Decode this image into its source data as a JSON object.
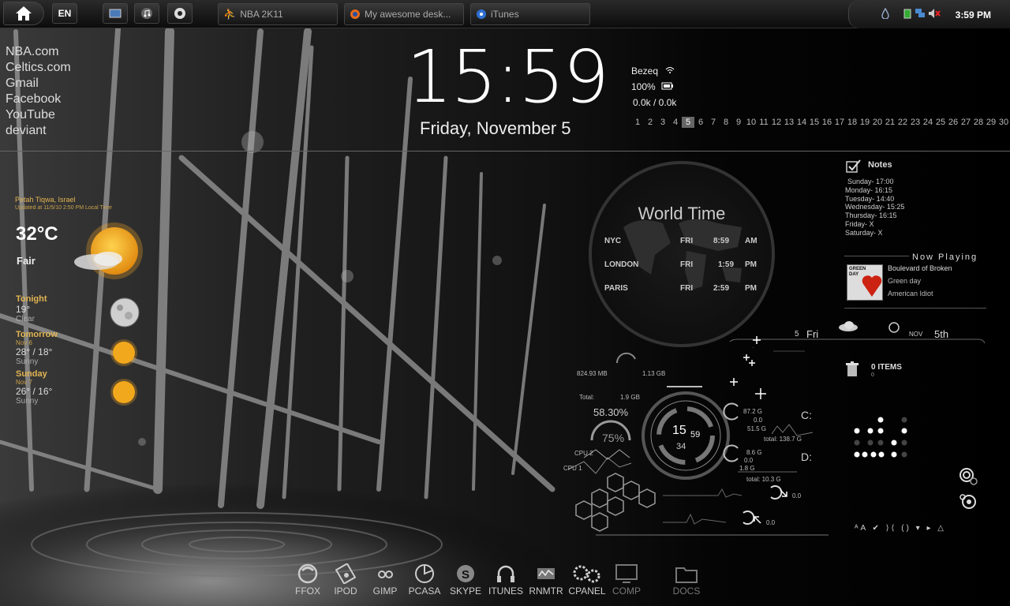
{
  "taskbar": {
    "language": "EN",
    "tasks": [
      {
        "label": "NBA 2K11",
        "icon": "nba-game-icon"
      },
      {
        "label": "My awesome desk...",
        "icon": "firefox-icon"
      },
      {
        "label": "iTunes",
        "icon": "itunes-icon"
      }
    ],
    "tray_time": "3:59 PM"
  },
  "links": [
    "NBA.com",
    "Celtics.com",
    "Gmail",
    "Facebook",
    "YouTube",
    "deviant"
  ],
  "clock": {
    "time": "15:59",
    "date": "Friday, November 5"
  },
  "network": {
    "provider": "Bezeq",
    "battery": "100%",
    "traffic": "0.0k / 0.0k"
  },
  "calendar": {
    "days": [
      "1",
      "2",
      "3",
      "4",
      "5",
      "6",
      "7",
      "8",
      "9",
      "10",
      "11",
      "12",
      "13",
      "14",
      "15",
      "16",
      "17",
      "18",
      "19",
      "20",
      "21",
      "22",
      "23",
      "24",
      "25",
      "26",
      "27",
      "28",
      "29",
      "30"
    ],
    "today": "5"
  },
  "weather": {
    "location": "Petah Tiqwa, Israel",
    "updated": "Updated at 11/5/10 2:50 PM Local Time",
    "temperature": "32°C",
    "condition": "Fair",
    "forecast": [
      {
        "day": "Tonight",
        "subdate": "",
        "temp": "19°",
        "cond": "Clear",
        "icon": "moon-icon"
      },
      {
        "day": "Tomorrow",
        "subdate": "Nov 6",
        "temp": "28° / 18°",
        "cond": "Sunny",
        "icon": "sun-icon"
      },
      {
        "day": "Sunday",
        "subdate": "Nov 7",
        "temp": "26° / 16°",
        "cond": "Sunny",
        "icon": "sun-icon"
      }
    ]
  },
  "world_time": {
    "title": "World Time",
    "cities": [
      {
        "city": "NYC",
        "day": "FRI",
        "time": "8:59",
        "ampm": "AM"
      },
      {
        "city": "LONDON",
        "day": "FRI",
        "time": "1:59",
        "ampm": "PM"
      },
      {
        "city": "PARIS",
        "day": "FRI",
        "time": "2:59",
        "ampm": "PM"
      }
    ]
  },
  "notes": {
    "title": "Notes",
    "items": [
      "Sunday- 17:00",
      "Monday- 16:15",
      "Tuesday- 14:40",
      "Wednesday- 15:25",
      "Thursday- 16:15",
      "Friday- X",
      "Saturday- X"
    ]
  },
  "now_playing": {
    "title": "Now Playing",
    "song": "Boulevard of Broken",
    "artist": "Green day",
    "album": "American Idiot",
    "cover_text": "GREEN DAY"
  },
  "date_strip": {
    "num": "5",
    "day": "Fri",
    "month": "NOV",
    "date": "5th"
  },
  "trash": {
    "items": "0 ITEMS",
    "count": "0"
  },
  "system": {
    "mem_used": "824.93 MB",
    "mem_total": "1.13 GB",
    "total_label": "Total:",
    "total_value": "1.9 GB",
    "cpu_percent": "58.30%",
    "cpu_percent2": "75%",
    "cpu2_label": "CPU 2",
    "cpu1_label": "CPU 1",
    "hud_hour": "15",
    "hud_min": "59",
    "hud_sec": "34",
    "c_label": "C:",
    "c_used": "87.2 G",
    "c_zero": "0.0",
    "c_free": "51.5 G",
    "c_total": "total: 138.7 G",
    "d_label": "D:",
    "d_used": "8.6 G",
    "d_zero": "0.0",
    "d_free": "1.8 G",
    "d_total": "total: 10.3 G",
    "down_rate": "0.0",
    "up_rate": "0.0"
  },
  "dock": [
    {
      "label": "FFOX",
      "icon": "firefox-icon"
    },
    {
      "label": "IPOD",
      "icon": "ipod-icon"
    },
    {
      "label": "GIMP",
      "icon": "gimp-icon"
    },
    {
      "label": "PCASA",
      "icon": "picasa-icon"
    },
    {
      "label": "SKYPE",
      "icon": "skype-icon"
    },
    {
      "label": "ITUNES",
      "icon": "headphones-icon"
    },
    {
      "label": "RNMTR",
      "icon": "rainmeter-icon"
    },
    {
      "label": "CPANEL",
      "icon": "gears-icon"
    },
    {
      "label": "COMP",
      "icon": "monitor-icon"
    },
    {
      "label": "DOCS",
      "icon": "folder-icon"
    }
  ]
}
